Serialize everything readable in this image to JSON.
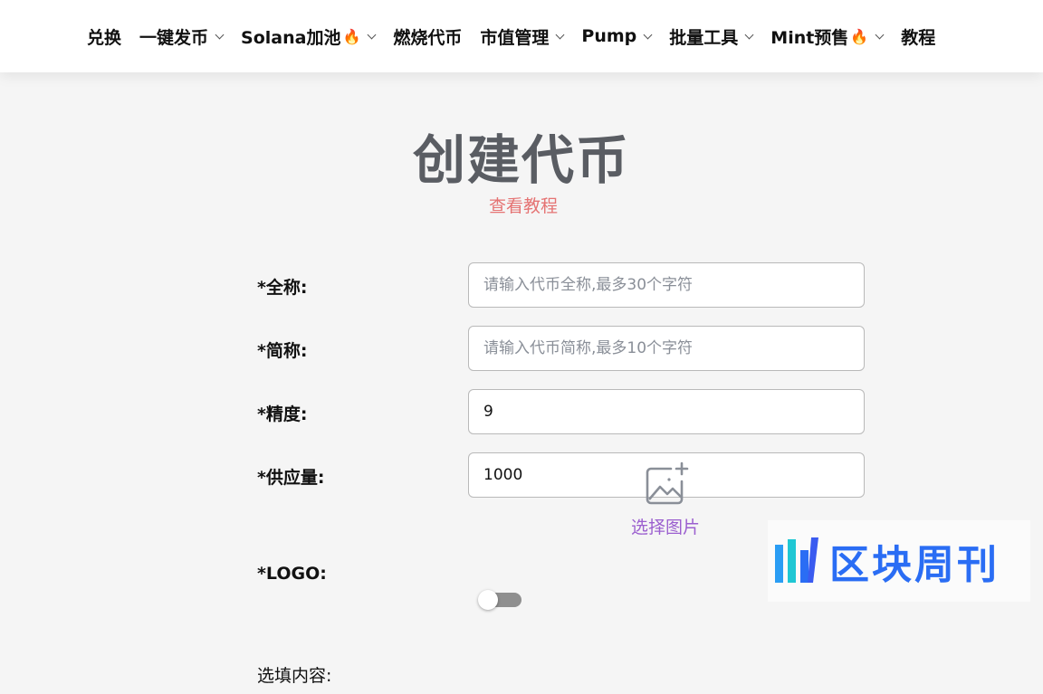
{
  "nav": {
    "items": [
      {
        "label": "兑换",
        "fire": false,
        "dropdown": false
      },
      {
        "label": "一键发币",
        "fire": false,
        "dropdown": true
      },
      {
        "label": "Solana加池",
        "fire": true,
        "dropdown": true
      },
      {
        "label": "燃烧代币",
        "fire": false,
        "dropdown": false
      },
      {
        "label": "市值管理",
        "fire": false,
        "dropdown": true
      },
      {
        "label": "Pump",
        "fire": false,
        "dropdown": true
      },
      {
        "label": "批量工具",
        "fire": false,
        "dropdown": true
      },
      {
        "label": "Mint预售",
        "fire": true,
        "dropdown": true
      },
      {
        "label": "教程",
        "fire": false,
        "dropdown": false
      }
    ],
    "fire_icon": "🔥"
  },
  "page": {
    "title": "创建代币",
    "tutorial_link": "查看教程"
  },
  "form": {
    "full_name": {
      "label": "*全称:",
      "value": "",
      "placeholder": "请输入代币全称,最多30个字符"
    },
    "symbol": {
      "label": "*简称:",
      "value": "",
      "placeholder": "请输入代币简称,最多10个字符"
    },
    "decimals": {
      "label": "*精度:",
      "value": "9",
      "placeholder": ""
    },
    "supply": {
      "label": "*供应量:",
      "value": "1000",
      "placeholder": ""
    },
    "logo": {
      "label": "*LOGO:",
      "upload_label": "选择图片",
      "icon": "image-add-icon"
    },
    "optional": {
      "label": "选填内容:",
      "toggle_on": false
    }
  },
  "watermark": {
    "text": "区块周刊"
  },
  "colors": {
    "title": "#5a5d63",
    "link": "#e57373",
    "upload": "#9b5fcf",
    "watermark": "#2a6df4"
  }
}
